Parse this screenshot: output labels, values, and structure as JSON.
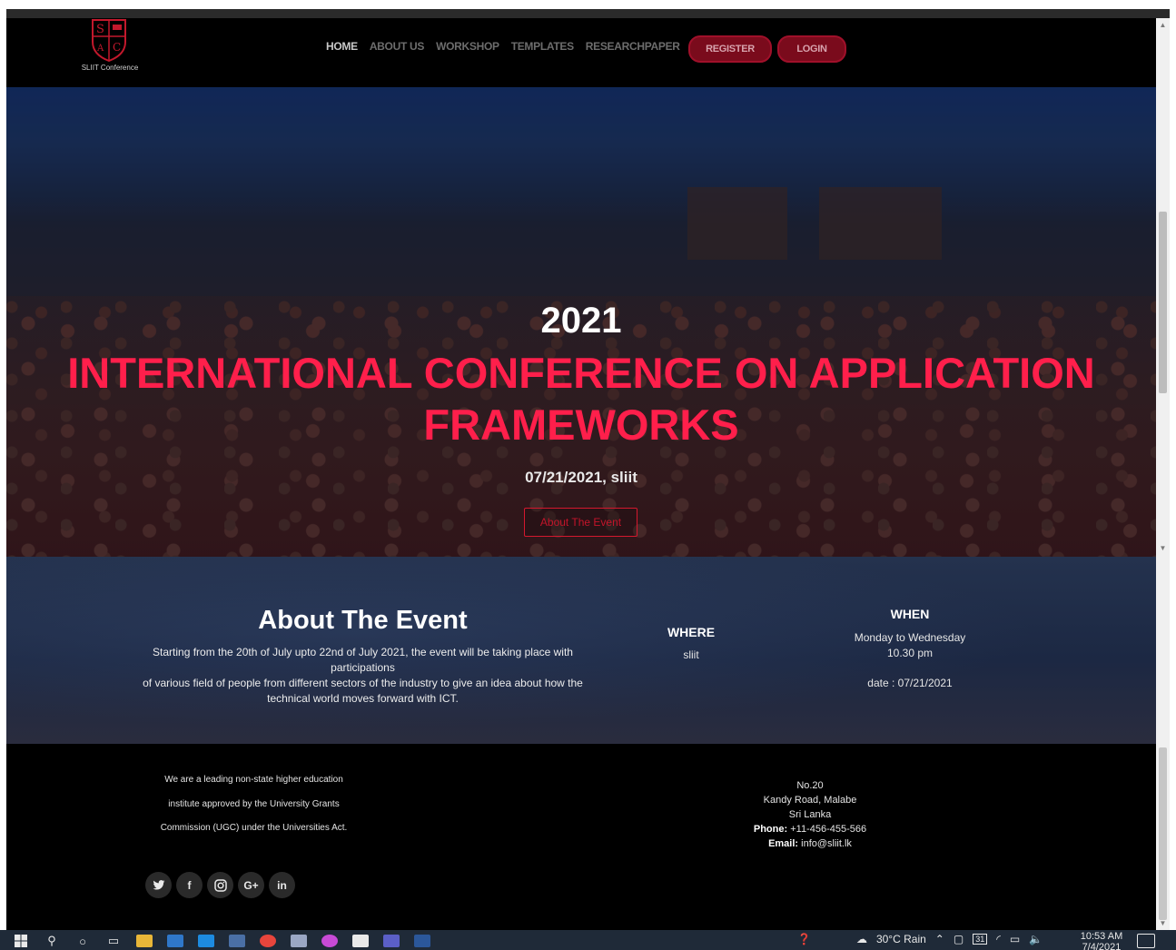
{
  "nav": {
    "logo_caption": "SLIIT Conference",
    "logo_letters": [
      "S",
      "A",
      "C"
    ],
    "items": [
      {
        "label": "HOME",
        "active": true
      },
      {
        "label": "ABOUT US",
        "active": false
      },
      {
        "label": "WORKSHOP",
        "active": false
      },
      {
        "label": "TEMPLATES",
        "active": false
      },
      {
        "label": "RESEARCHPAPER",
        "active": false
      }
    ],
    "register_label": "REGISTER",
    "login_label": "LOGIN"
  },
  "hero": {
    "year": "2021",
    "title": "INTERNATIONAL CONFERENCE ON APPLICATION FRAMEWORKS",
    "date_place": "07/21/2021, sliit",
    "cta_label": "About The Event"
  },
  "about": {
    "title": "About The Event",
    "text_line1": "Starting from the 20th of July upto 22nd of July 2021, the event will be taking place with participations",
    "text_line2": "of various field of people from different sectors of the industry to give an idea about how the technical world moves forward with ICT.",
    "where_heading": "WHERE",
    "where_value": "sliit",
    "when_heading": "WHEN",
    "when_days": "Monday to Wednesday",
    "when_time": "10.30 pm",
    "when_date": "date : 07/21/2021"
  },
  "footer": {
    "desc_lines": [
      "We are a leading non-state higher education",
      "institute approved by the University Grants",
      "Commission (UGC) under the Universities Act."
    ],
    "address_line1": "No.20",
    "address_line2": "Kandy Road, Malabe",
    "address_line3": "Sri Lanka",
    "phone_label": "Phone:",
    "phone_value": "+11-456-455-566",
    "email_label": "Email:",
    "email_value": "info@sliit.lk",
    "socials": [
      {
        "name": "twitter-icon",
        "glyph": "🐦"
      },
      {
        "name": "facebook-icon",
        "glyph": "f"
      },
      {
        "name": "instagram-icon",
        "glyph": "◎"
      },
      {
        "name": "google-plus-icon",
        "glyph": "G+"
      },
      {
        "name": "linkedin-icon",
        "glyph": "in"
      }
    ]
  },
  "taskbar": {
    "weather": "30°C  Rain",
    "time": "10:53 AM",
    "date": "7/4/2021",
    "calendar_day": "31"
  },
  "colors": {
    "accent": "#ff1f4b",
    "button_fill": "#7a0b1c",
    "nav_bg": "#000000",
    "footer_bg": "#000000"
  }
}
